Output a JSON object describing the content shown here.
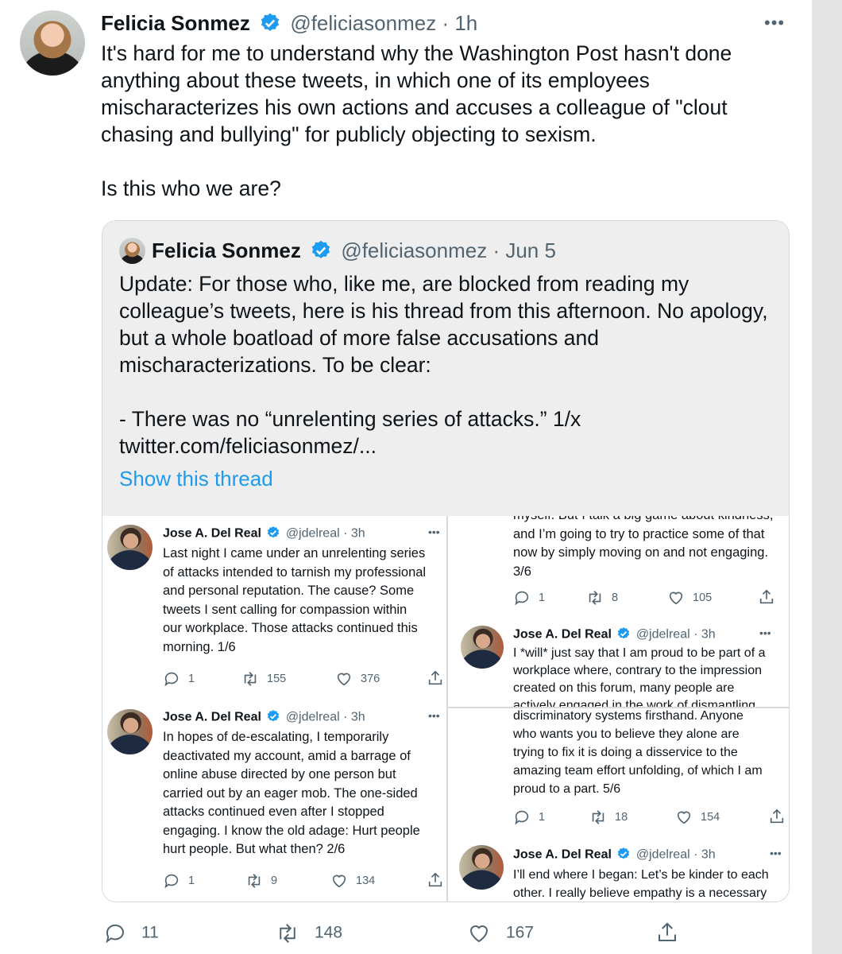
{
  "tweet": {
    "name": "Felicia Sonmez",
    "handle": "@feliciasonmez",
    "time": "· 1h",
    "text": "It's hard for me to understand why the Washington Post hasn't done anything about these tweets, in which one of its employees mischaracterizes his own actions and accuses a colleague of \"clout chasing and bullying\" for publicly objecting to sexism.\n\nIs this who we are?",
    "more": "•••",
    "actions": {
      "replies": "11",
      "retweets": "148",
      "likes": "167"
    }
  },
  "quote": {
    "name": "Felicia Sonmez",
    "handle": "@feliciasonmez",
    "time": "· Jun 5",
    "text": "Update: For those who, like me, are blocked from reading my colleague’s tweets, here is his thread from this afternoon. No apology, but a whole boatload of more false accusations and mischaracterizations. To be clear:\n\n- There was no “unrelenting series of attacks.” 1/x\ntwitter.com/feliciasonmez/...",
    "show_thread": "Show this thread"
  },
  "screenshots": {
    "author": "Jose A. Del Real",
    "handle": "@jdelreal",
    "time": "· 3h",
    "more": "•••",
    "t1": {
      "text": "Last night I came under an unrelenting series\nof attacks intended to tarnish my professional\nand personal reputation. The cause? Some\ntweets I sent calling for compassion within\nour workplace. Those attacks continued this\nmorning. 1/6",
      "replies": "1",
      "retweets": "155",
      "likes": "376"
    },
    "t2": {
      "text": "In hopes of de-escalating, I temporarily\ndeactivated my account, amid a barrage of\nonline abuse directed by one person but\ncarried out by an eager mob. The one-sided\nattacks continued even after I stopped\nengaging. I know the old adage: Hurt people\nhurt people. But what then? 2/6",
      "replies": "1",
      "retweets": "9",
      "likes": "134"
    },
    "t3": {
      "text": "myself. But I talk a big game about kindness,\nand I’m going to try to practice some of that\nnow by simply moving on and not engaging.\n3/6",
      "replies": "1",
      "retweets": "8",
      "likes": "105"
    },
    "t4": {
      "text": "I *will* just say that I am proud to be part of a\nworkplace where, contrary to the impression\ncreated on this forum, many people are\nactively engaged in the work of dismantling"
    },
    "t5": {
      "text": "discriminatory systems firsthand. Anyone\nwho wants you to believe they alone are\ntrying to fix it is doing a disservice to the\namazing team effort unfolding, of which I am\nproud to a part. 5/6",
      "replies": "1",
      "retweets": "18",
      "likes": "154"
    },
    "t6": {
      "text": "I’ll end where I began: Let’s be kinder to each\nother. I really believe empathy is a necessary"
    }
  }
}
